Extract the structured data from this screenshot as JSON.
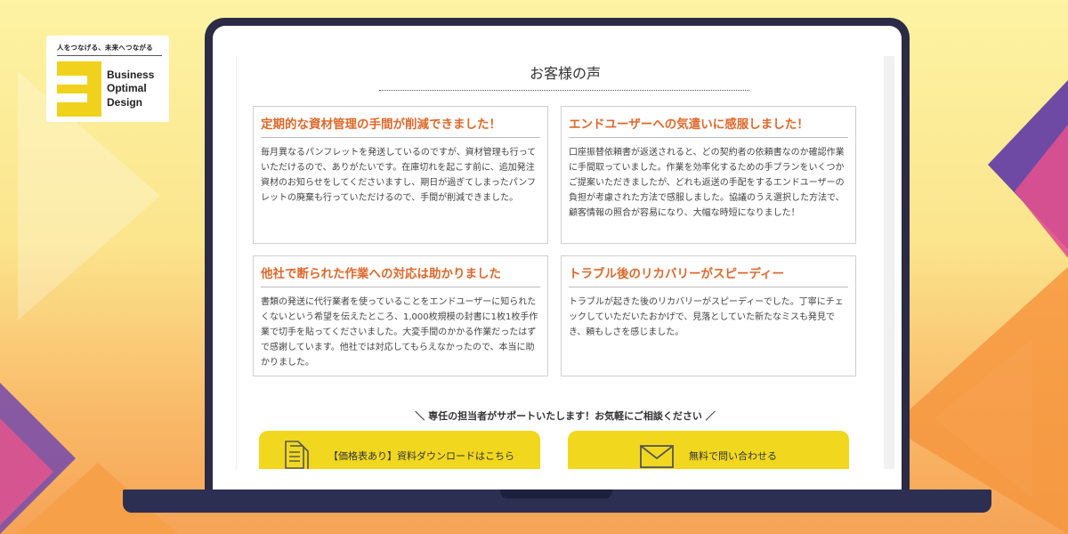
{
  "logo": {
    "tagline": "人をつなげる、未来へつながる",
    "mark_letter": "B",
    "words": [
      "Business",
      "Optimal",
      "Design"
    ]
  },
  "page": {
    "section_title": "お客様の声",
    "testimonials": [
      {
        "title": "定期的な資材管理の手間が削減できました！",
        "body": "毎月異なるパンフレットを発送しているのですが、資材管理も行っていただけるので、ありがたいです。在庫切れを起こす前に、追加発注資材のお知らせをしてくださいますし、期日が過ぎてしまったパンフレットの廃棄も行っていただけるので、手間が削減できました。"
      },
      {
        "title": "エンドユーザーへの気遣いに感服しました！",
        "body": "口座振替依頼書が返送されると、どの契約者の依頼書なのか確認作業に手間取っていました。作業を効率化するための手プランをいくつかご提案いただきましたが、どれも返送の手配をするエンドユーザーの負担が考慮された方法で感服しました。協議のうえ選択した方法で、顧客情報の照合が容易になり、大幅な時短になりました！"
      },
      {
        "title": "他社で断られた作業への対応は助かりました",
        "body": "書類の発送に代行業者を使っていることをエンドユーザーに知られたくないという希望を伝えたところ、1,000枚規模の封書に1枚1枚手作業で切手を貼ってくださいました。大変手間のかかる作業だったはずで感謝しています。他社では対応してもらえなかったので、本当に助かりました。"
      },
      {
        "title": "トラブル後のリカバリーがスピーディー",
        "body": "トラブルが起きた後のリカバリーがスピーディーでした。丁寧にチェックしていただいたおかげで、見落としていた新たなミスも発見でき、頼もしさを感じました。"
      }
    ],
    "support_line": "＼ 専任の担当者がサポートいたします！お気軽にご相談ください ／",
    "cta_download": {
      "label": "【価格表あり】資料ダウンロードはこちら",
      "icon": "document-icon"
    },
    "cta_contact": {
      "label": "無料で問い合わせる",
      "icon": "envelope-icon"
    }
  },
  "colors": {
    "accent_title": "#e0682a",
    "cta_yellow": "#f1d81f",
    "laptop_frame": "#2b2b45",
    "logo_yellow": "#f0d21d"
  }
}
